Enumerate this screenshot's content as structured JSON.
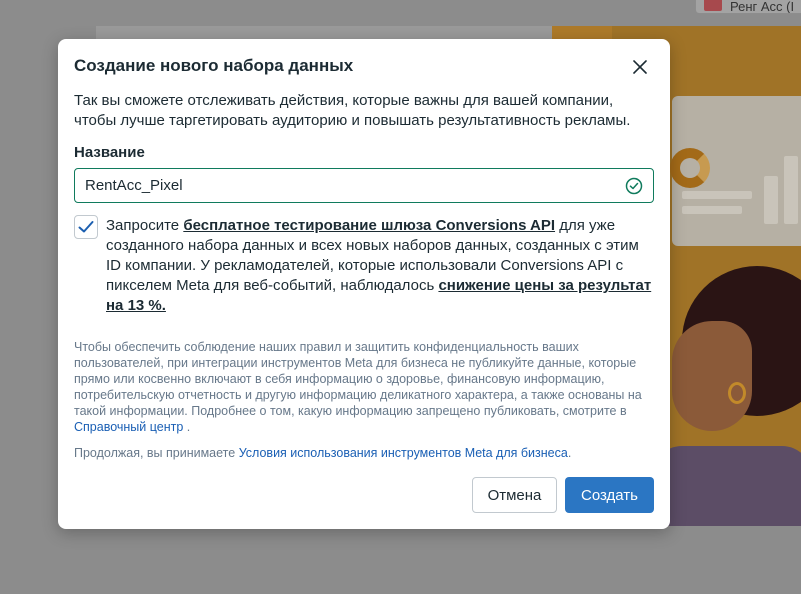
{
  "background": {
    "top_pill_text": "Ренг Асс (I"
  },
  "modal": {
    "title": "Создание нового набора данных",
    "description": "Так вы сможете отслеживать действия, которые важны для вашей компании, чтобы лучше таргетировать аудиторию и повышать результативность рекламы.",
    "name_label": "Название",
    "name_value": "RentAcc_Pixel",
    "checkbox_checked": true,
    "checkbox_text": {
      "prefix": "Запросите ",
      "link1": "бесплатное тестирование шлюза Conversions API",
      "middle": " для уже созданного набора данных и всех новых наборов данных, созданных с этим ID компании. У рекламодателей, которые использовали Conversions API с пикселем Meta для веб-событий, наблюдалось ",
      "link2": "снижение цены за результат на 13 %."
    },
    "privacy": {
      "text": "Чтобы обеспечить соблюдение наших правил и защитить конфиденциальность ваших пользователей, при интеграции инструментов Meta для бизнеса не публикуйте данные, которые прямо или косвенно включают в себя информацию о здоровье, финансовую информацию, потребительскую отчетность и другую информацию деликатного характера, а также основаны на такой информации. Подробнее о том, какую информацию запрещено публиковать, смотрите в ",
      "link": "Справочный центр",
      "suffix": " ."
    },
    "terms": {
      "prefix": "Продолжая, вы принимаете ",
      "link": "Условия использования инструментов Meta для бизнеса",
      "suffix": "."
    },
    "cancel_label": "Отмена",
    "create_label": "Создать"
  },
  "colors": {
    "primary": "#2b76c3",
    "success": "#107b5d",
    "link": "#1a5fb4",
    "text": "#1c2b33",
    "muted": "#67788a"
  },
  "icons": {
    "close": "close-icon",
    "valid": "check-circle-icon",
    "checkbox": "checkmark-icon"
  }
}
